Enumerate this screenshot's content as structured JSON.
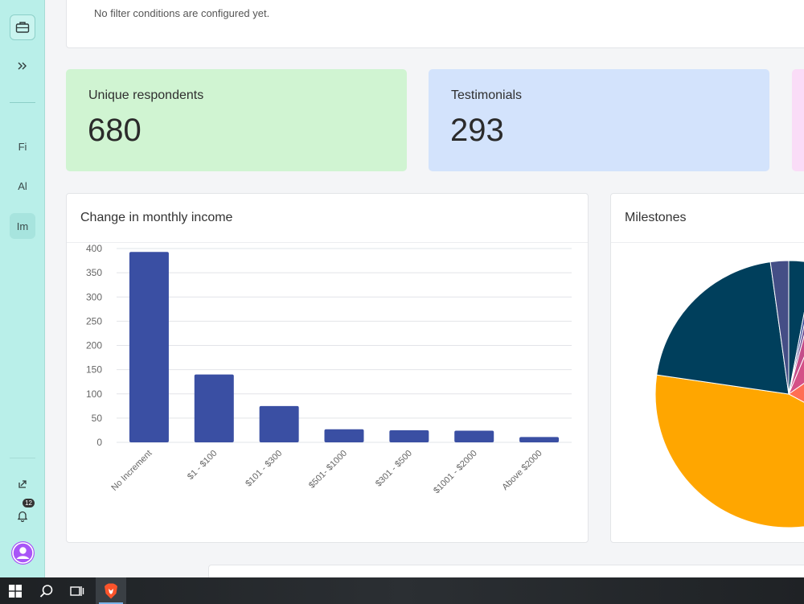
{
  "sidebar": {
    "items": [
      {
        "label": "Fi"
      },
      {
        "label": "Al"
      },
      {
        "label": "Im"
      }
    ],
    "notifications_count": "12"
  },
  "filter": {
    "message": "No filter conditions are configured yet."
  },
  "stats": [
    {
      "label": "Unique respondents",
      "value": "680",
      "color": "#d0f4d2"
    },
    {
      "label": "Testimonials",
      "value": "293",
      "color": "#d3e3fc"
    },
    {
      "label": "",
      "value": "",
      "color": "#fadcf7"
    }
  ],
  "income_card": {
    "title": "Change in monthly income"
  },
  "milestones_card": {
    "title": "Milestones"
  },
  "chart_data": [
    {
      "type": "bar",
      "title": "Change in monthly income",
      "categories": [
        "No Increment",
        "$1 - $100",
        "$101 - $300",
        "$501- $1000",
        "$301 - $500",
        "$1001 - $2000",
        "Above $2000"
      ],
      "values": [
        393,
        140,
        75,
        27,
        25,
        24,
        11
      ],
      "ylim": [
        0,
        400
      ],
      "yticks": [
        0,
        50,
        100,
        150,
        200,
        250,
        300,
        350,
        400
      ],
      "grid": true,
      "bar_color": "#3a4fa3"
    },
    {
      "type": "pie",
      "title": "Milestones",
      "slices": [
        {
          "value": 3.0,
          "color": "#003f5c"
        },
        {
          "value": 0.5,
          "color": "#3b4f9a"
        },
        {
          "value": 0.6,
          "color": "#6a4c93"
        },
        {
          "value": 2.2,
          "color": "#c44d8a"
        },
        {
          "value": 9.0,
          "color": "#d45087"
        },
        {
          "value": 17.5,
          "color": "#ff6e54"
        },
        {
          "value": 44.5,
          "color": "#ffa600"
        },
        {
          "value": 20.5,
          "color": "#003f5c"
        },
        {
          "value": 2.2,
          "color": "#444e86"
        }
      ]
    }
  ],
  "taskbar": {
    "items": [
      "windows-start",
      "search",
      "task-view",
      "brave-browser"
    ]
  }
}
